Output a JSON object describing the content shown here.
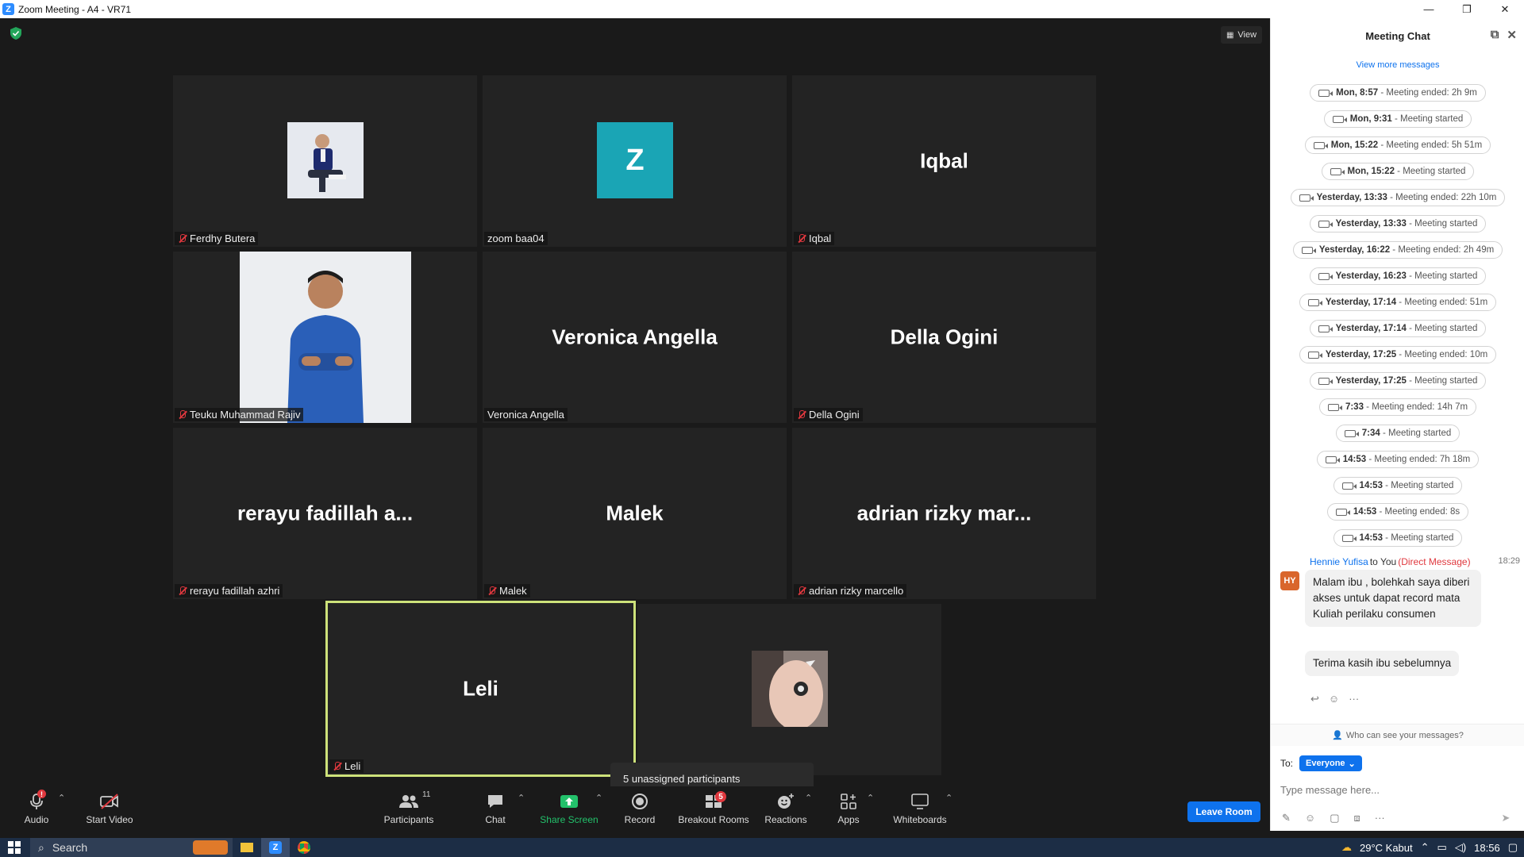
{
  "window": {
    "title": "Zoom Meeting - A4 - VR71",
    "controls": [
      "—",
      "❐",
      "✕"
    ]
  },
  "meeting": {
    "view_label": "View",
    "tiles": [
      {
        "id": "ferdhy",
        "display": "",
        "label": "Ferdhy Butera",
        "muted": true
      },
      {
        "id": "zoom",
        "display": "Z",
        "label": "zoom baa04",
        "muted": false
      },
      {
        "id": "iqbal",
        "display": "Iqbal",
        "label": "Iqbal",
        "muted": true
      },
      {
        "id": "teuku",
        "display": "",
        "label": "Teuku Muhammad Rajiv",
        "muted": true
      },
      {
        "id": "veronica",
        "display": "Veronica Angella",
        "label": "Veronica Angella",
        "muted": false
      },
      {
        "id": "della",
        "display": "Della Ogini",
        "label": "Della Ogini",
        "muted": true
      },
      {
        "id": "rerayu",
        "display": "rerayu fadillah a...",
        "label": "rerayu fadillah azhri",
        "muted": true
      },
      {
        "id": "malek",
        "display": "Malek",
        "label": "Malek",
        "muted": true
      },
      {
        "id": "adrian",
        "display": "adrian rizky mar...",
        "label": "adrian rizky marcello",
        "muted": true
      },
      {
        "id": "leli",
        "display": "Leli",
        "label": "Leli",
        "muted": true
      },
      {
        "id": "photo",
        "display": "",
        "label": "",
        "muted": false
      }
    ],
    "tooltip": "5 unassigned participants"
  },
  "toolbar": {
    "audio": "Audio",
    "start_video": "Start Video",
    "participants": "Participants",
    "participants_count": "11",
    "chat": "Chat",
    "share_screen": "Share Screen",
    "record": "Record",
    "breakout_rooms": "Breakout Rooms",
    "breakout_badge": "5",
    "reactions": "Reactions",
    "apps": "Apps",
    "whiteboards": "Whiteboards",
    "leave_room": "Leave Room",
    "audio_badge": "!"
  },
  "chat": {
    "title": "Meeting Chat",
    "view_more": "View more messages",
    "system_messages": [
      {
        "time": "Mon, 8:57",
        "text": " - Meeting ended: 2h 9m"
      },
      {
        "time": "Mon, 9:31",
        "text": " - Meeting started"
      },
      {
        "time": "Mon, 15:22",
        "text": " - Meeting ended: 5h 51m"
      },
      {
        "time": "Mon, 15:22",
        "text": " - Meeting started"
      },
      {
        "time": "Yesterday, 13:33",
        "text": " - Meeting ended: 22h 10m"
      },
      {
        "time": "Yesterday, 13:33",
        "text": " - Meeting started"
      },
      {
        "time": "Yesterday, 16:22",
        "text": " - Meeting ended: 2h 49m"
      },
      {
        "time": "Yesterday, 16:23",
        "text": " - Meeting started"
      },
      {
        "time": "Yesterday, 17:14",
        "text": " - Meeting ended: 51m"
      },
      {
        "time": "Yesterday, 17:14",
        "text": " - Meeting started"
      },
      {
        "time": "Yesterday, 17:25",
        "text": " - Meeting ended: 10m"
      },
      {
        "time": "Yesterday, 17:25",
        "text": " - Meeting started"
      },
      {
        "time": "7:33",
        "text": " - Meeting ended: 14h 7m"
      },
      {
        "time": "7:34",
        "text": " - Meeting started"
      },
      {
        "time": "14:53",
        "text": " - Meeting ended: 7h 18m"
      },
      {
        "time": "14:53",
        "text": " - Meeting started"
      },
      {
        "time": "14:53",
        "text": " - Meeting ended: 8s"
      },
      {
        "time": "14:53",
        "text": " - Meeting started"
      }
    ],
    "dm": {
      "sender": "Hennie Yufisa",
      "to": "to You",
      "direct_label": "(Direct Message)",
      "time": "18:29",
      "initials": "HY",
      "messages": [
        "Malam ibu , bolehkah saya diberi akses untuk dapat record mata Kuliah perilaku consumen",
        "Terima kasih ibu sebelumnya"
      ]
    },
    "who_can_see": "Who can see your messages?",
    "to_label": "To:",
    "recipient": "Everyone",
    "input_placeholder": "Type message here..."
  },
  "taskbar": {
    "search_label": "Search",
    "weather": "29°C  Kabut",
    "clock": "18:56"
  }
}
